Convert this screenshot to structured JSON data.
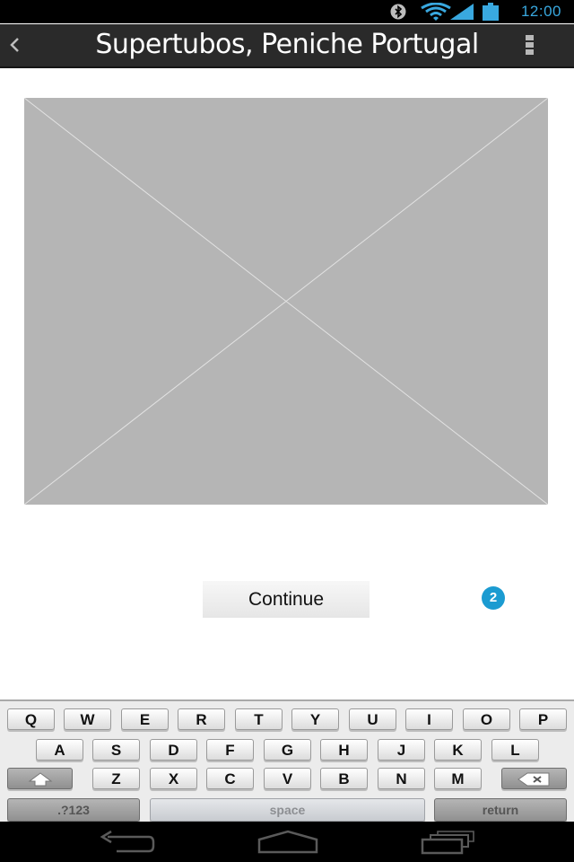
{
  "status_bar": {
    "time": "12:00",
    "icons": [
      "bluetooth-icon",
      "wifi-icon",
      "signal-icon",
      "battery-icon"
    ],
    "accent_color": "#39a8df"
  },
  "action_bar": {
    "back_icon": "chevron-left-icon",
    "title": "Supertubos, Peniche Portugal",
    "menu_icon": "overflow-menu-icon"
  },
  "content": {
    "image_placeholder": "image-placeholder",
    "continue_label": "Continue",
    "badge": "2",
    "badge_color": "#1b9bd1"
  },
  "keyboard": {
    "row1": [
      "Q",
      "W",
      "E",
      "R",
      "T",
      "Y",
      "U",
      "I",
      "O",
      "P"
    ],
    "row2": [
      "A",
      "S",
      "D",
      "F",
      "G",
      "H",
      "J",
      "K",
      "L"
    ],
    "row3": [
      "Z",
      "X",
      "C",
      "V",
      "B",
      "N",
      "M"
    ],
    "symbols_label": ".?123",
    "space_label": "space",
    "return_label": "return",
    "shift_icon": "shift-icon",
    "delete_icon": "backspace-icon"
  },
  "nav_bar": {
    "icons": [
      "back-icon",
      "home-icon",
      "recent-apps-icon"
    ]
  }
}
